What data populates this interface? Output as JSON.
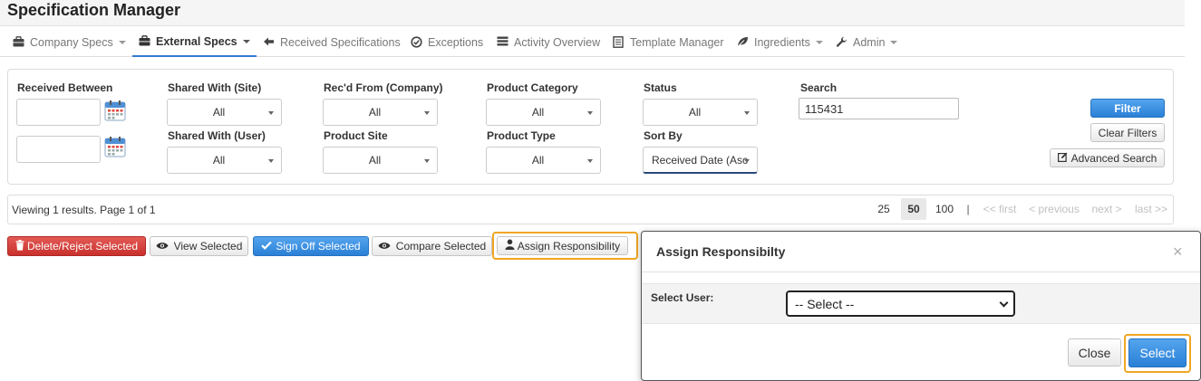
{
  "app": {
    "title": "Specification Manager"
  },
  "nav": {
    "items": [
      {
        "label": "Company Specs",
        "icon": "briefcase-icon",
        "dropdown": true,
        "active": false
      },
      {
        "label": "External Specs",
        "icon": "briefcase-icon",
        "dropdown": true,
        "active": true
      },
      {
        "label": "Received Specifications",
        "icon": "arrow-left-icon",
        "dropdown": false,
        "active": false
      },
      {
        "label": "Exceptions",
        "icon": "check-circle-icon",
        "dropdown": false,
        "active": false
      },
      {
        "label": "Activity Overview",
        "icon": "list-icon",
        "dropdown": false,
        "active": false
      },
      {
        "label": "Template Manager",
        "icon": "document-icon",
        "dropdown": false,
        "active": false
      },
      {
        "label": "Ingredients",
        "icon": "leaf-icon",
        "dropdown": true,
        "active": false
      },
      {
        "label": "Admin",
        "icon": "wrench-icon",
        "dropdown": true,
        "active": false
      }
    ]
  },
  "filters": {
    "received_between": "Received Between",
    "shared_site": {
      "label": "Shared With (Site)",
      "value": "All"
    },
    "shared_user": {
      "label": "Shared With (User)",
      "value": "All"
    },
    "recd_from": {
      "label": "Rec'd From (Company)",
      "value": "All"
    },
    "product_site": {
      "label": "Product Site",
      "value": "All"
    },
    "product_category": {
      "label": "Product Category",
      "value": "All"
    },
    "product_type": {
      "label": "Product Type",
      "value": "All"
    },
    "status": {
      "label": "Status",
      "value": "All"
    },
    "sort_by": {
      "label": "Sort By",
      "value": "Received Date (Asc"
    },
    "search": {
      "label": "Search",
      "value": "115431"
    },
    "filter_button": "Filter",
    "clear_button": "Clear Filters",
    "advanced_button": "Advanced Search"
  },
  "results": {
    "viewing": "Viewing 1 results. Page 1 of 1",
    "page_sizes": [
      "25",
      "50",
      "100"
    ],
    "active_page_size": "50",
    "separator": "|",
    "first": "<< first",
    "previous": "< previous",
    "next": "next >",
    "last": "last >>"
  },
  "actions": {
    "delete": "Delete/Reject Selected",
    "view": "View Selected",
    "signoff": "Sign Off Selected",
    "compare": "Compare Selected",
    "assign": "Assign Responsibility"
  },
  "modal": {
    "title": "Assign Responsibilty",
    "close": "×",
    "select_user_label": "Select User:",
    "select_user_value": "-- Select --",
    "close_button": "Close",
    "select_button": "Select"
  },
  "colors": {
    "primary": "#2a80d6",
    "danger": "#c9302c",
    "highlight": "#f0a623"
  }
}
